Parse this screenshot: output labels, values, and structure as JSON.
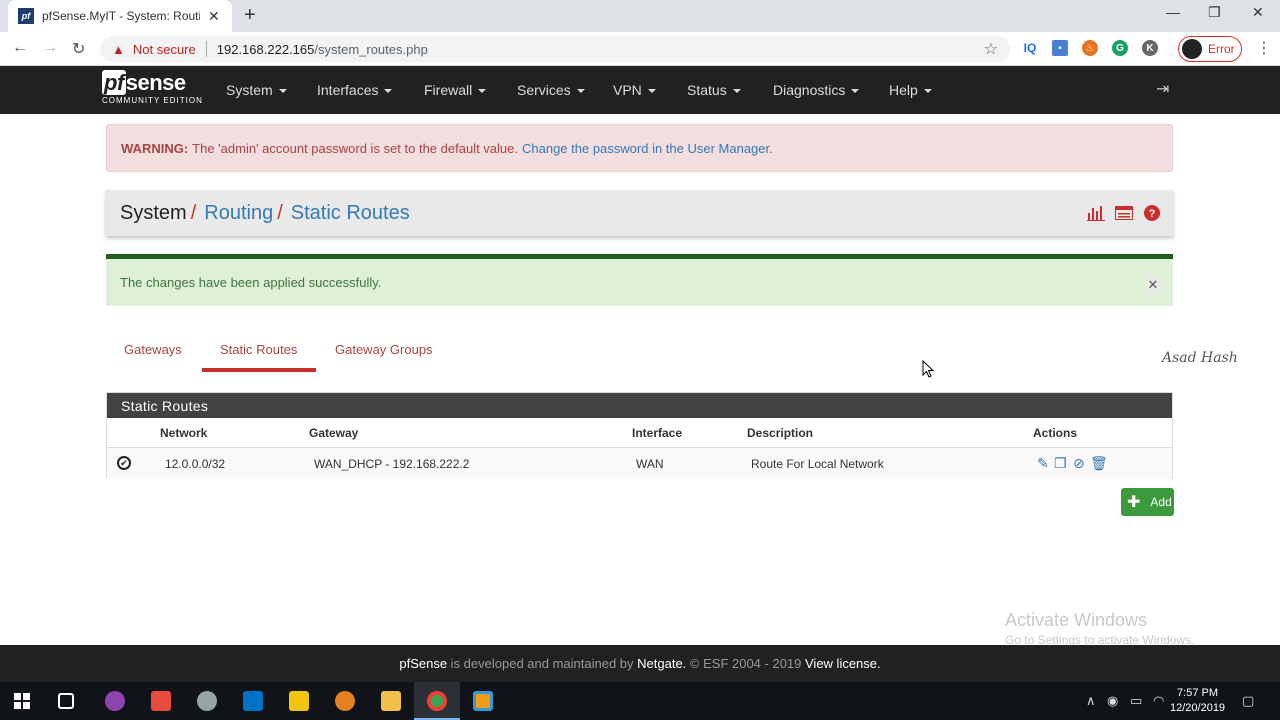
{
  "browser": {
    "tab_title": "pfSense.MyIT - System: Routing:",
    "not_secure": "Not secure",
    "url_host": "192.168.222.165",
    "url_path": "/system_routes.php",
    "profile_label": "Error"
  },
  "nav": {
    "logo_main": "sense",
    "logo_pf": "pf",
    "logo_sub": "COMMUNITY EDITION",
    "items": [
      "System",
      "Interfaces",
      "Firewall",
      "Services",
      "VPN",
      "Status",
      "Diagnostics",
      "Help"
    ]
  },
  "warning": {
    "label": "WARNING:",
    "text": "The 'admin' account password is set to the default value.",
    "link": "Change the password in the User Manager."
  },
  "breadcrumb": {
    "first": "System",
    "second": "Routing",
    "third": "Static Routes",
    "sep": "/"
  },
  "success": {
    "text": "The changes have been applied successfully."
  },
  "tabs": [
    "Gateways",
    "Static Routes",
    "Gateway Groups"
  ],
  "watermark": "Asad Hash",
  "table": {
    "title": "Static Routes",
    "headers": [
      "Network",
      "Gateway",
      "Interface",
      "Description",
      "Actions"
    ],
    "rows": [
      {
        "network": "12.0.0.0/32",
        "gateway": "WAN_DHCP - 192.168.222.2",
        "interface": "WAN",
        "description": "Route For Local Network"
      }
    ]
  },
  "add_button": "Add",
  "activate": {
    "title": "Activate Windows",
    "sub": "Go to Settings to activate Windows."
  },
  "footer": {
    "brand": "pfSense",
    "text1": " is developed and maintained by ",
    "company": "Netgate.",
    "text2": " © ESF 2004 - 2019 ",
    "license": "View license."
  },
  "clock": {
    "time": "7:57 PM",
    "date": "12/20/2019"
  },
  "colors": {
    "navbar": "#212121",
    "accent_red": "#c9302c",
    "link_blue": "#337ab7",
    "success_green": "#3c9a3c"
  }
}
